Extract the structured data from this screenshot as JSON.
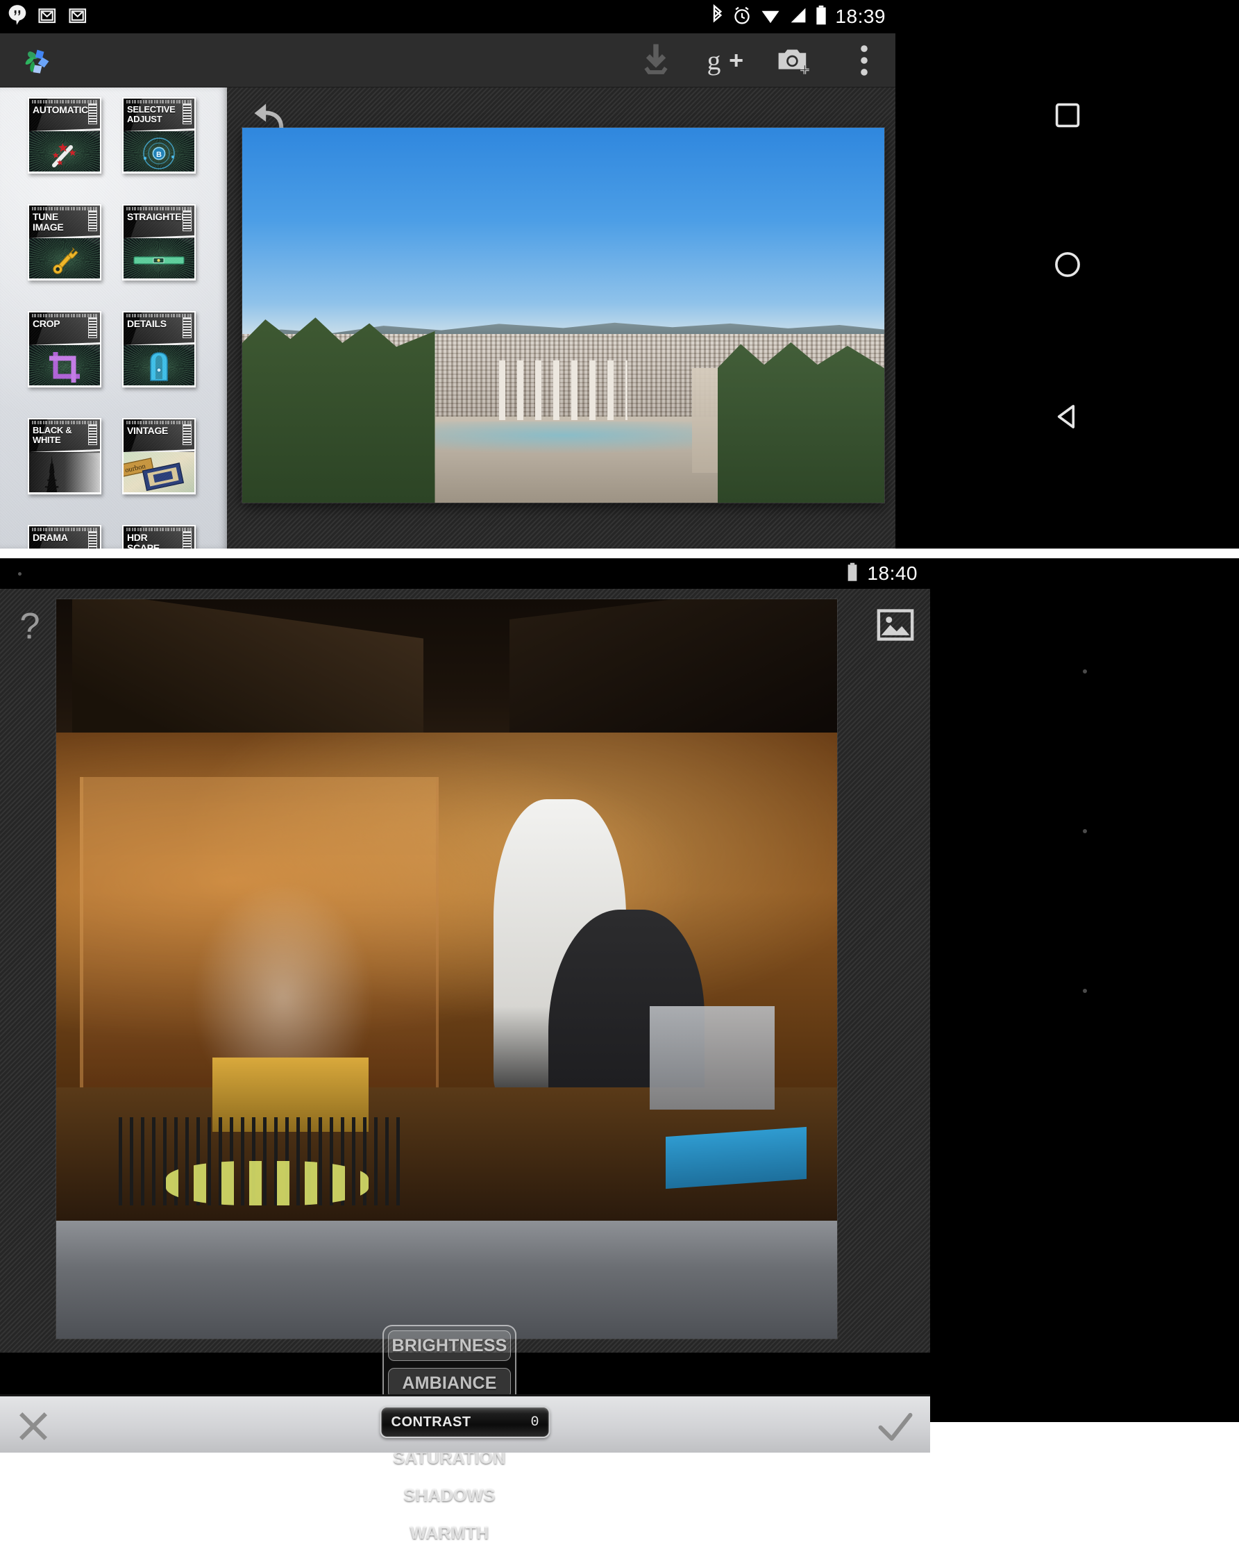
{
  "screen1": {
    "statusbar": {
      "time": "18:39",
      "left_icons": [
        "hangouts-icon",
        "gmail-icon",
        "gmail-icon"
      ],
      "right_icons": [
        "bluetooth-icon",
        "alarm-icon",
        "wifi-icon",
        "cell-signal-icon",
        "battery-icon"
      ]
    },
    "actionbar": {
      "app_logo": "snapseed-logo",
      "actions": [
        {
          "name": "export-save-icon",
          "glyph": "download"
        },
        {
          "name": "google-plus-share-icon",
          "glyph": "gplus"
        },
        {
          "name": "open-camera-icon",
          "glyph": "camera-plus"
        },
        {
          "name": "overflow-menu-icon",
          "glyph": "kebab"
        }
      ]
    },
    "filters": {
      "panel_name": "filter-panel",
      "items": [
        {
          "label": "AUTOMATIC",
          "icon": "magic-wand-icon"
        },
        {
          "label": "SELECTIVE ADJUST",
          "icon": "selective-b-icon"
        },
        {
          "label": "TUNE IMAGE",
          "icon": "wrench-icon"
        },
        {
          "label": "STRAIGHTEN",
          "icon": "spirit-level-icon"
        },
        {
          "label": "CROP",
          "icon": "crop-icon"
        },
        {
          "label": "DETAILS",
          "icon": "pencil-sharpener-icon"
        },
        {
          "label": "BLACK & WHITE",
          "icon": "eiffel-bw-icon"
        },
        {
          "label": "VINTAGE",
          "icon": "vintage-poster-icon"
        },
        {
          "label": "DRAMA",
          "icon": "drama-icon"
        },
        {
          "label": "HDR SCAPE",
          "icon": "hdr-icon"
        }
      ]
    },
    "editor": {
      "undo_icon": "undo-arrow-icon",
      "photo_name": "barcelona-placa-espanya-photo"
    },
    "navbar": {
      "buttons": [
        {
          "name": "nav-recents-button",
          "glyph": "square"
        },
        {
          "name": "nav-home-button",
          "glyph": "circle"
        },
        {
          "name": "nav-back-button",
          "glyph": "triangle"
        }
      ]
    }
  },
  "screen2": {
    "statusbar": {
      "time": "18:40",
      "right_icons": [
        "battery-icon"
      ]
    },
    "stage": {
      "help_icon": "help-question-icon",
      "gallery_icon": "image-gallery-icon",
      "photo_name": "restaurant-kitchen-grill-photo"
    },
    "adjust_menu": {
      "name": "tune-image-adjust-menu",
      "items": [
        {
          "label": "BRIGHTNESS",
          "selected": false
        },
        {
          "label": "AMBIANCE",
          "selected": false
        },
        {
          "label": "CONTRAST",
          "selected": true
        },
        {
          "label": "SATURATION",
          "selected": false
        },
        {
          "label": "SHADOWS",
          "selected": false
        },
        {
          "label": "WARMTH",
          "selected": false
        }
      ],
      "selected_color": "#1c7ddb"
    },
    "bottom": {
      "cancel_icon": "close-x-icon",
      "confirm_icon": "checkmark-icon",
      "slider_label": "CONTRAST",
      "slider_value": "0"
    }
  }
}
